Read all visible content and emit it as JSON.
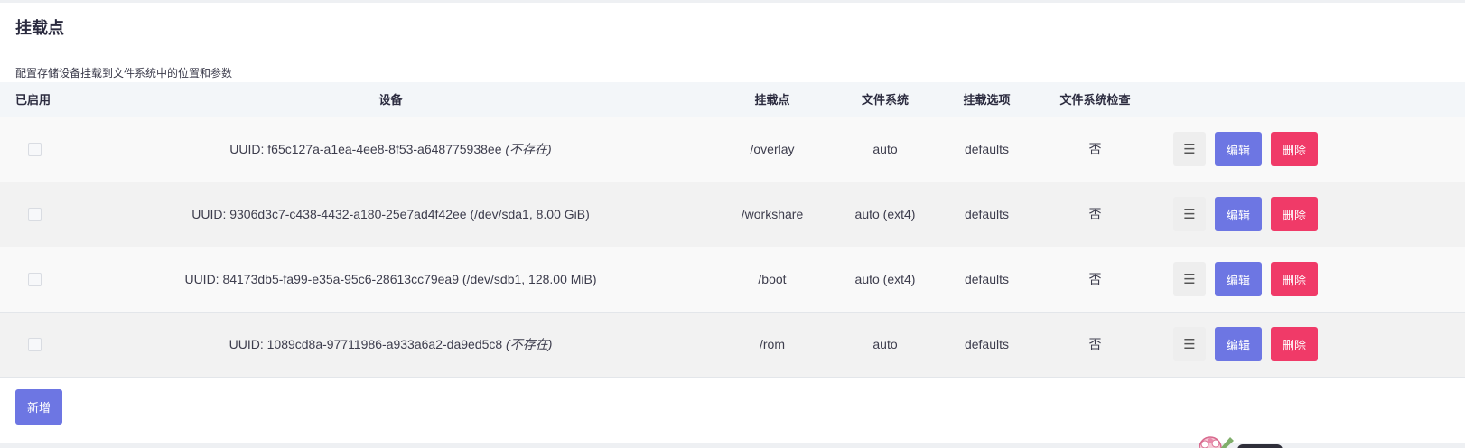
{
  "section": {
    "title": "挂载点",
    "description": "配置存储设备挂载到文件系统中的位置和参数"
  },
  "table": {
    "headers": {
      "enabled": "已启用",
      "device": "设备",
      "mountpoint": "挂载点",
      "filesystem": "文件系统",
      "options": "挂载选项",
      "fsck": "文件系统检查"
    },
    "rows": [
      {
        "enabled": false,
        "device": "UUID: f65c127a-a1ea-4ee8-8f53-a648775938ee",
        "device_note": "(不存在)",
        "mountpoint": "/overlay",
        "filesystem": "auto",
        "options": "defaults",
        "fsck": "否"
      },
      {
        "enabled": false,
        "device": "UUID: 9306d3c7-c438-4432-a180-25e7ad4f42ee (/dev/sda1, 8.00 GiB)",
        "device_note": "",
        "mountpoint": "/workshare",
        "filesystem": "auto (ext4)",
        "options": "defaults",
        "fsck": "否"
      },
      {
        "enabled": false,
        "device": "UUID: 84173db5-fa99-e35a-95c6-28613cc79ea9 (/dev/sdb1, 128.00 MiB)",
        "device_note": "",
        "mountpoint": "/boot",
        "filesystem": "auto (ext4)",
        "options": "defaults",
        "fsck": "否"
      },
      {
        "enabled": false,
        "device": "UUID: 1089cd8a-97711986-a933a6a2-da9ed5c8",
        "device_note": "(不存在)",
        "mountpoint": "/rom",
        "filesystem": "auto",
        "options": "defaults",
        "fsck": "否"
      }
    ]
  },
  "actions": {
    "drag_label": "☰",
    "edit_label": "编辑",
    "delete_label": "删除",
    "add_label": "新增"
  },
  "colors": {
    "primary": "#6d76e3",
    "danger": "#f03a68",
    "header_bg": "#f3f6f9"
  },
  "icons": {
    "drag": "drag-handle-icon",
    "corner": "flower-mascot-icon"
  }
}
